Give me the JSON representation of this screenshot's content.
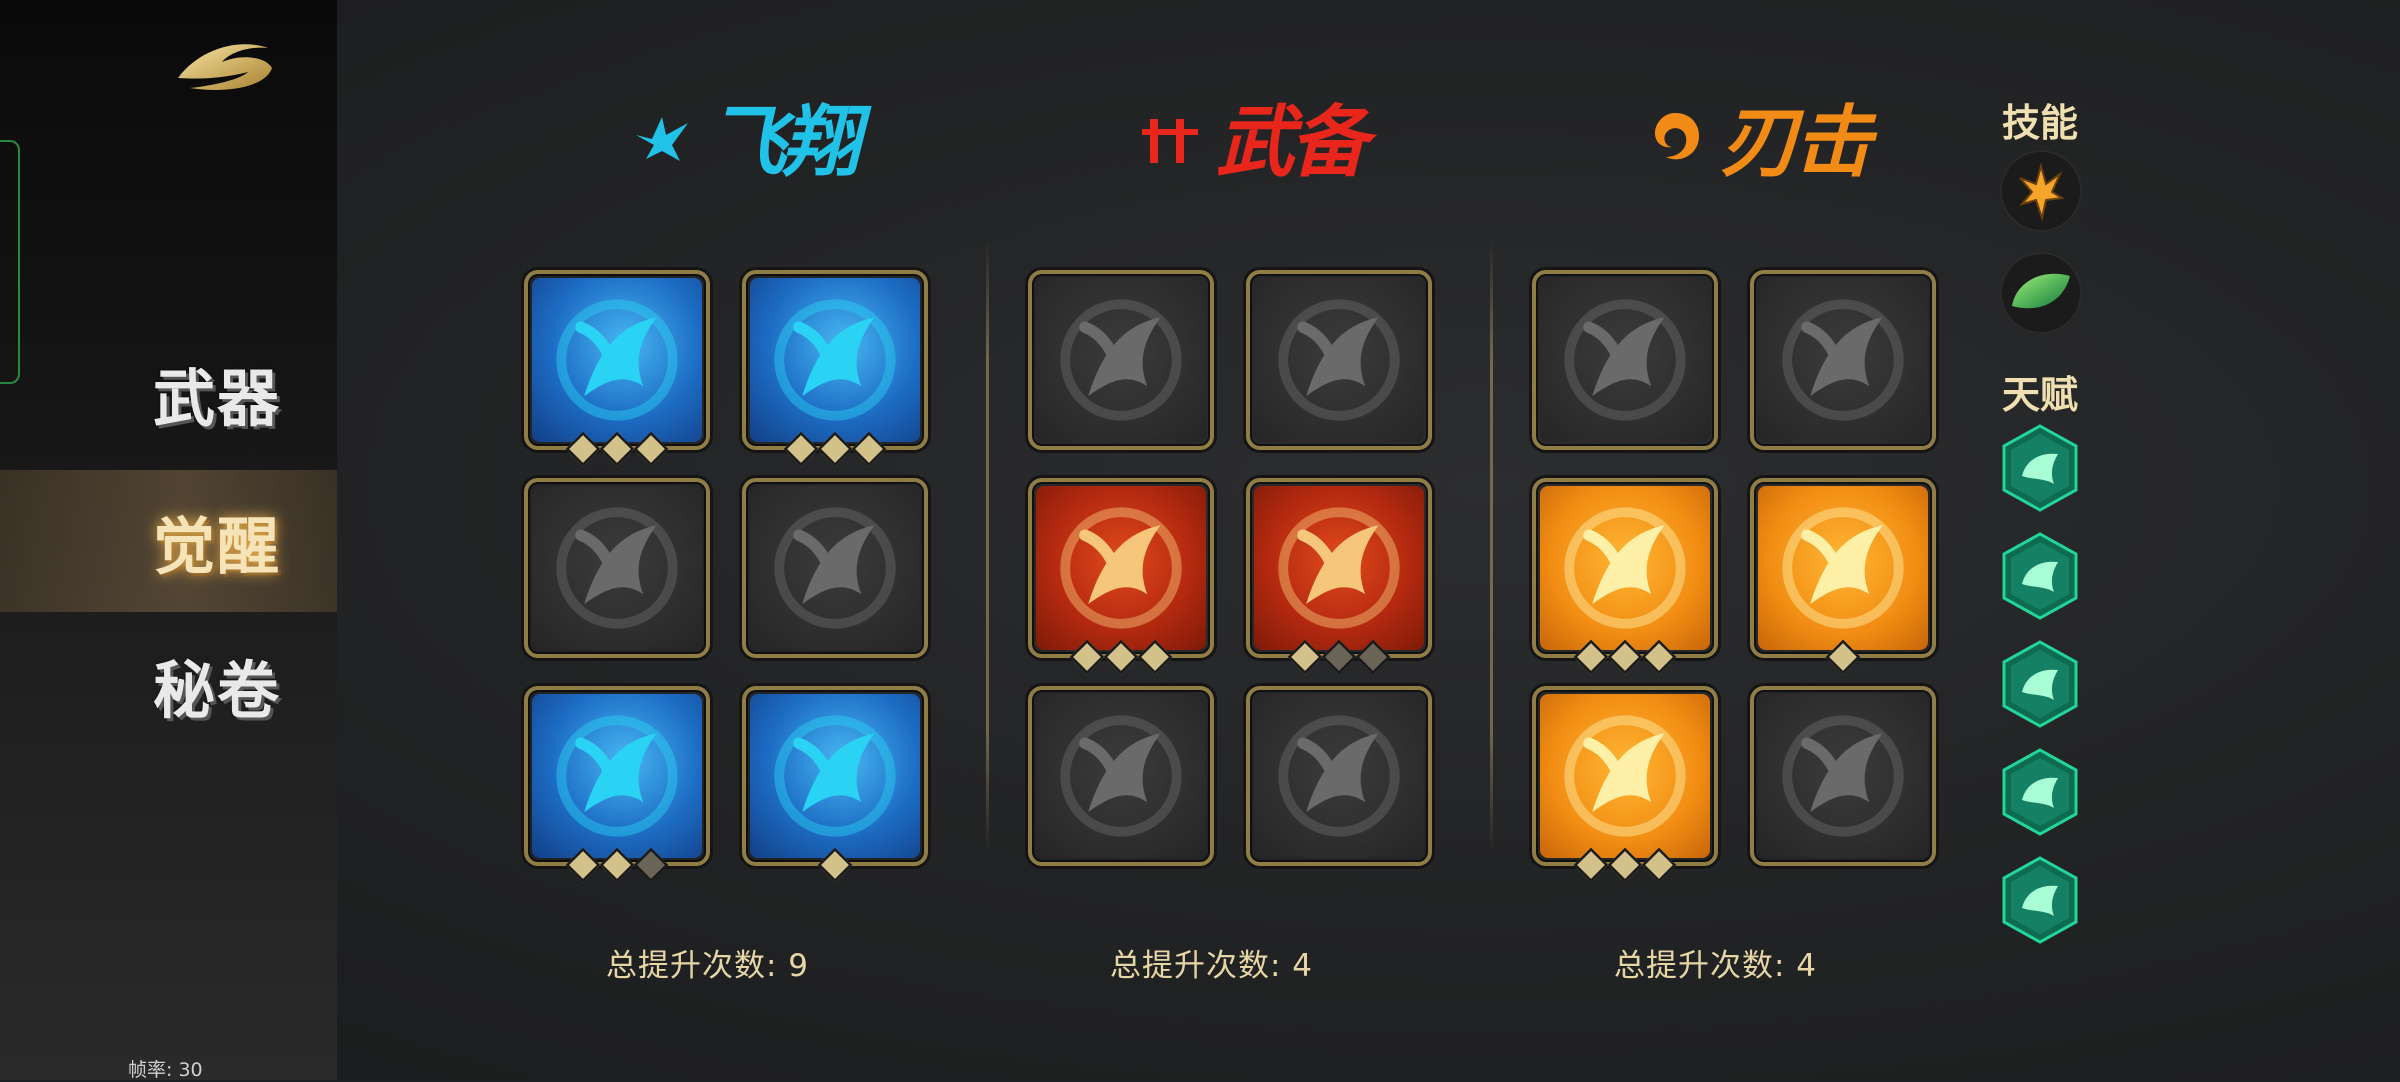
{
  "sidebar": {
    "logo_icon": "golden-swoosh-logo",
    "items": [
      {
        "label": "武器",
        "active": false
      },
      {
        "label": "觉醒",
        "active": true
      },
      {
        "label": "秘卷",
        "active": false
      }
    ],
    "fps_label": "帧率: 30"
  },
  "sections": [
    {
      "title": "飞翔",
      "emblem": "bird-icon",
      "color": "#21c2e8",
      "count_label": "总提升次数: 9",
      "tiles": [
        {
          "icon": "claw-slash-icon",
          "style": "blue",
          "pips": [
            1,
            1,
            1
          ]
        },
        {
          "icon": "eagle-claw-icon",
          "style": "blue",
          "pips": [
            1,
            1,
            1
          ]
        },
        {
          "icon": "demon-figure-icon",
          "style": "grey",
          "pips": []
        },
        {
          "icon": "dash-strike-icon",
          "style": "grey",
          "pips": []
        },
        {
          "icon": "wing-icon",
          "style": "blue",
          "pips": [
            1,
            1,
            0
          ]
        },
        {
          "icon": "talon-swirl-icon",
          "style": "blue",
          "pips": [
            1
          ]
        }
      ]
    },
    {
      "title": "武备",
      "emblem": "weapon-rack-icon",
      "color": "#e8261c",
      "count_label": "总提升次数: 4",
      "tiles": [
        {
          "icon": "sword-ground-icon",
          "style": "grey",
          "pips": []
        },
        {
          "icon": "muscle-beast-icon",
          "style": "grey",
          "pips": []
        },
        {
          "icon": "fist-whirl-icon",
          "style": "red",
          "pips": [
            1,
            1,
            1
          ]
        },
        {
          "icon": "fist-power-icon",
          "style": "red",
          "pips": [
            1,
            0,
            0
          ]
        },
        {
          "icon": "spin-blade-icon",
          "style": "grey",
          "pips": []
        },
        {
          "icon": "fist-burst-icon",
          "style": "grey",
          "pips": []
        }
      ]
    },
    {
      "title": "刃击",
      "emblem": "swirl-flame-icon",
      "color": "#f28a16",
      "count_label": "总提升次数: 4",
      "tiles": [
        {
          "icon": "blade-claw-icon",
          "style": "grey",
          "pips": []
        },
        {
          "icon": "vortex-icon",
          "style": "grey",
          "pips": []
        },
        {
          "icon": "fierce-eye-icon",
          "style": "orange",
          "pips": [
            1,
            1,
            1
          ]
        },
        {
          "icon": "fire-swirl-icon",
          "style": "orange",
          "pips": [
            1
          ]
        },
        {
          "icon": "heal-swirl-icon",
          "style": "orange",
          "pips": [
            1,
            1,
            1
          ]
        },
        {
          "icon": "tail-swipe-icon",
          "style": "grey",
          "pips": []
        }
      ]
    }
  ],
  "right_panel": {
    "skills_label": "技能",
    "skills": [
      {
        "icon": "golden-claw-icon"
      },
      {
        "icon": "green-leaf-icon"
      }
    ],
    "talents_label": "天赋",
    "talents": [
      {
        "icon": "bird-talent-icon"
      },
      {
        "icon": "winged-heart-icon"
      },
      {
        "icon": "shield-talent-icon"
      },
      {
        "icon": "double-wing-icon"
      },
      {
        "icon": "leaf-talent-icon"
      }
    ]
  }
}
